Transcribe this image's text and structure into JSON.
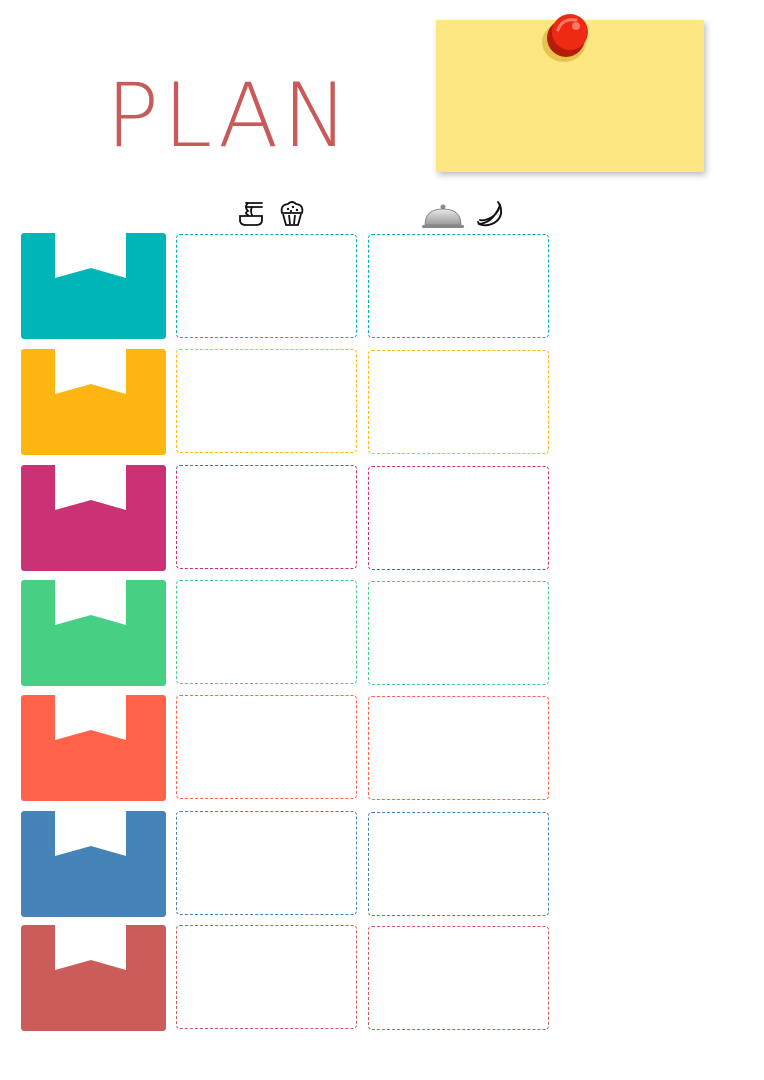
{
  "title": "PLAN",
  "columns": [
    {
      "icons": [
        "noodle-bowl-icon",
        "muffin-icon"
      ]
    },
    {
      "icons": [
        "cloche-icon",
        "banana-icon"
      ]
    }
  ],
  "rows": [
    {
      "color": "#00b5b8"
    },
    {
      "color": "#ffb611"
    },
    {
      "color": "#cb3276"
    },
    {
      "color": "#47cf84"
    },
    {
      "color": "#ff634a"
    },
    {
      "color": "#4583b8"
    },
    {
      "color": "#cc5c5a"
    }
  ],
  "note_color": "#fde783",
  "pin_color": "#ee2a12"
}
